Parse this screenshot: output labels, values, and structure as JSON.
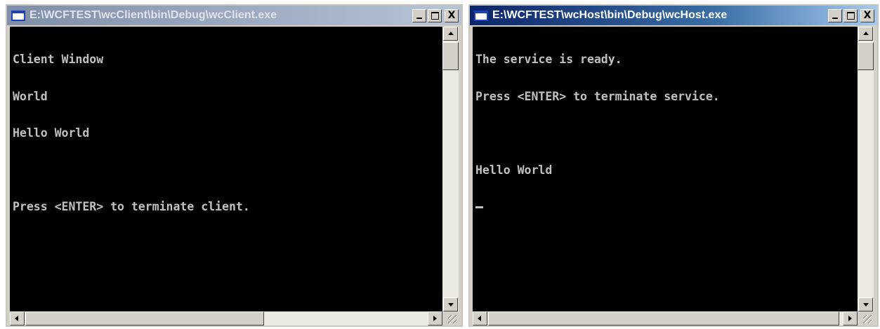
{
  "client_window": {
    "title": "E:\\WCFTEST\\wcClient\\bin\\Debug\\wcClient.exe",
    "state": "inactive",
    "controls": {
      "minimize": "_",
      "maximize": "□",
      "close": "X"
    },
    "console_lines": [
      "Client Window",
      "World",
      "Hello World",
      "",
      "Press <ENTER> to terminate client."
    ]
  },
  "host_window": {
    "title": "E:\\WCFTEST\\wcHost\\bin\\Debug\\wcHost.exe",
    "state": "active",
    "controls": {
      "minimize": "_",
      "maximize": "□",
      "close": "X"
    },
    "console_lines": [
      "The service is ready.",
      "Press <ENTER> to terminate service.",
      "",
      "Hello World"
    ],
    "cursor": "_"
  },
  "colors": {
    "console_background": "#000000",
    "console_text": "#c0c0c0",
    "active_titlebar": "#0a246a",
    "inactive_titlebar": "#7f8ea8"
  }
}
